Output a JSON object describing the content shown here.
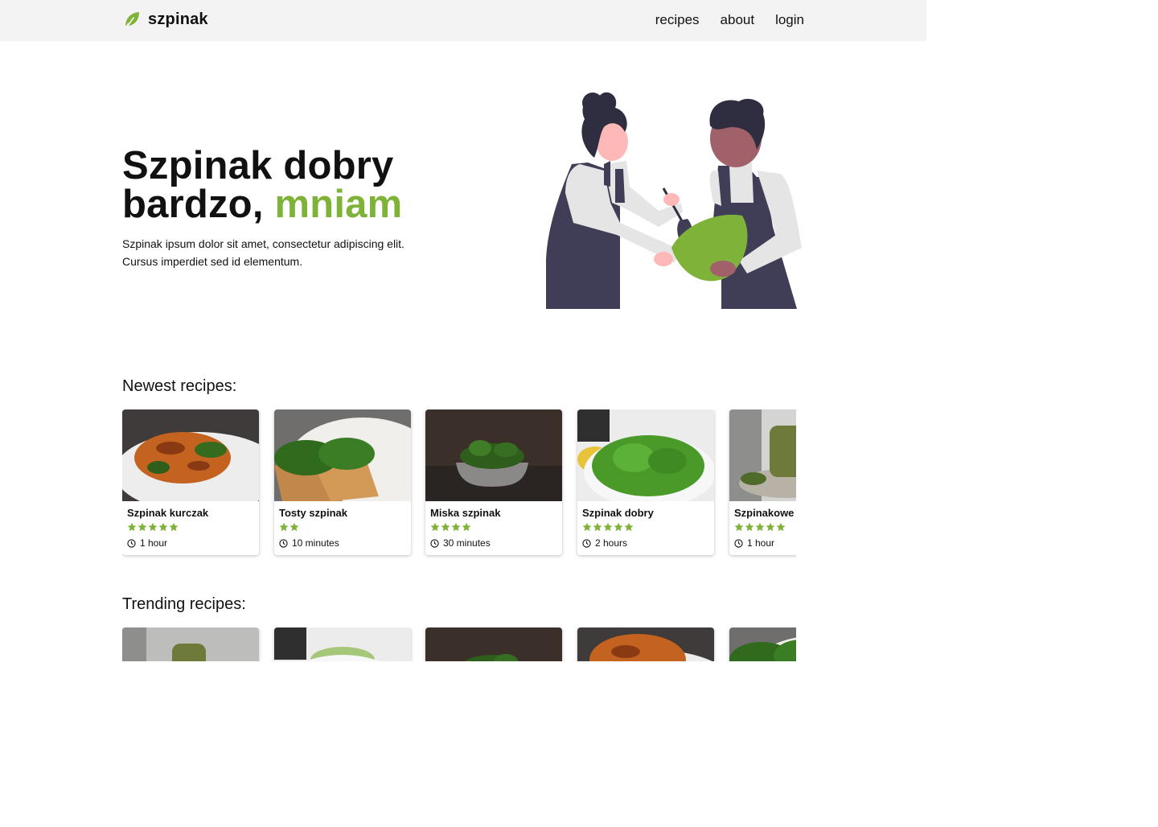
{
  "nav": {
    "brand": "szpinak",
    "logo_icon": "spinach-leaf-icon",
    "links": [
      "recipes",
      "about",
      "login"
    ]
  },
  "hero": {
    "title_line1": "Szpinak dobry",
    "title_line2": "bardzo,",
    "title_accent": "mniam",
    "description": "Szpinak ipsum dolor sit amet, consectetur adipiscing elit. Cursus imperdiet sed id elementum.",
    "illustration": "two-cooks-illustration"
  },
  "sections": {
    "newest_title": "Newest recipes:",
    "trending_title": "Trending recipes:"
  },
  "newest": [
    {
      "name": "Szpinak kurczak",
      "rating": 5,
      "time": "1 hour",
      "image": "spinach-chicken-photo"
    },
    {
      "name": "Tosty szpinak",
      "rating": 2,
      "time": "10 minutes",
      "image": "spinach-toast-photo"
    },
    {
      "name": "Miska szpinak",
      "rating": 4,
      "time": "30 minutes",
      "image": "spinach-bowl-photo"
    },
    {
      "name": "Szpinak dobry",
      "rating": 5,
      "time": "2 hours",
      "image": "spinach-salad-photo"
    },
    {
      "name": "Szpinakowe",
      "rating": 5,
      "time": "1 hour",
      "image": "spinach-pancakes-photo"
    }
  ],
  "trending": [
    {
      "image": "spinach-pancakes-photo"
    },
    {
      "image": "spinach-salad-photo"
    },
    {
      "image": "spinach-bowl-photo"
    },
    {
      "image": "spinach-chicken-photo"
    },
    {
      "image": "spinach-toast-photo"
    }
  ],
  "colors": {
    "accent": "#7fb238",
    "nav_background": "#f3f3f3",
    "apron": "#403d56",
    "text": "#111111"
  }
}
